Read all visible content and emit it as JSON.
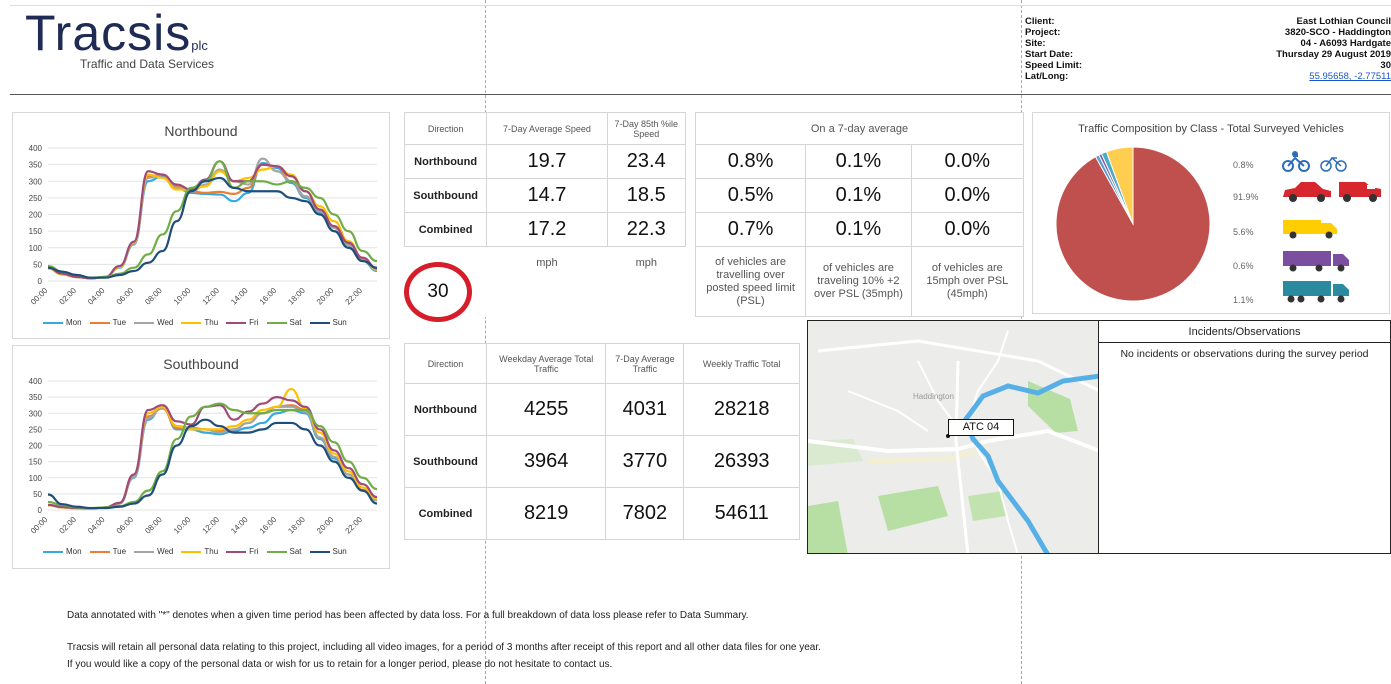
{
  "header": {
    "logo_text": "Tracsis",
    "logo_suffix": "plc",
    "logo_subtitle": "Traffic and Data Services",
    "info": [
      {
        "label": "Client:",
        "value": "East Lothian Council"
      },
      {
        "label": "Project:",
        "value": "3820-SCO - Haddington"
      },
      {
        "label": "Site:",
        "value": "04 - A6093 Hardgate"
      },
      {
        "label": "Start Date:",
        "value": "Thursday 29 August 2019"
      },
      {
        "label": "Speed Limit:",
        "value": "30"
      },
      {
        "label": "Lat/Long:",
        "value": "55.95658, -2.77511"
      }
    ]
  },
  "chart_data": [
    {
      "type": "line",
      "title": "Northbound",
      "x": [
        "00:00",
        "01:00",
        "02:00",
        "03:00",
        "04:00",
        "05:00",
        "06:00",
        "07:00",
        "08:00",
        "09:00",
        "10:00",
        "11:00",
        "12:00",
        "13:00",
        "14:00",
        "15:00",
        "16:00",
        "17:00",
        "18:00",
        "19:00",
        "20:00",
        "21:00",
        "22:00",
        "23:00"
      ],
      "xticks": [
        "00:00",
        "02:00",
        "04:00",
        "06:00",
        "08:00",
        "10:00",
        "12:00",
        "14:00",
        "16:00",
        "18:00",
        "20:00",
        "22:00"
      ],
      "ylim": [
        0,
        400
      ],
      "yticks": [
        0,
        50,
        100,
        150,
        200,
        250,
        300,
        350,
        400
      ],
      "series": [
        {
          "name": "Mon",
          "color": "#35a9e0",
          "values": [
            40,
            22,
            12,
            8,
            12,
            40,
            110,
            300,
            315,
            280,
            265,
            262,
            260,
            240,
            265,
            355,
            340,
            295,
            250,
            205,
            150,
            100,
            60,
            30
          ]
        },
        {
          "name": "Tue",
          "color": "#ed7d31",
          "values": [
            38,
            20,
            12,
            8,
            12,
            42,
            115,
            315,
            320,
            285,
            270,
            265,
            268,
            262,
            280,
            350,
            345,
            300,
            255,
            210,
            160,
            110,
            65,
            35
          ]
        },
        {
          "name": "Wed",
          "color": "#a5a5a5",
          "values": [
            38,
            20,
            12,
            8,
            12,
            42,
            112,
            310,
            318,
            280,
            268,
            290,
            335,
            300,
            290,
            368,
            330,
            300,
            255,
            210,
            160,
            108,
            62,
            33
          ]
        },
        {
          "name": "Thu",
          "color": "#ffc000",
          "values": [
            38,
            20,
            12,
            8,
            12,
            42,
            115,
            320,
            310,
            275,
            275,
            285,
            330,
            300,
            310,
            335,
            345,
            320,
            270,
            225,
            180,
            120,
            70,
            35
          ]
        },
        {
          "name": "Fri",
          "color": "#9e4a7a",
          "values": [
            40,
            22,
            12,
            8,
            12,
            45,
            118,
            330,
            320,
            290,
            275,
            305,
            360,
            300,
            300,
            350,
            345,
            315,
            270,
            215,
            165,
            115,
            70,
            38
          ]
        },
        {
          "name": "Sat",
          "color": "#70ad47",
          "values": [
            45,
            28,
            18,
            10,
            12,
            22,
            40,
            80,
            140,
            210,
            280,
            300,
            360,
            280,
            300,
            300,
            290,
            300,
            280,
            250,
            200,
            150,
            90,
            60
          ]
        },
        {
          "name": "Sun",
          "color": "#1f4e79",
          "values": [
            40,
            28,
            18,
            10,
            10,
            18,
            30,
            55,
            90,
            180,
            270,
            300,
            310,
            280,
            270,
            270,
            270,
            250,
            240,
            200,
            150,
            100,
            60,
            40
          ]
        }
      ]
    },
    {
      "type": "line",
      "title": "Southbound",
      "x": [
        "00:00",
        "01:00",
        "02:00",
        "03:00",
        "04:00",
        "05:00",
        "06:00",
        "07:00",
        "08:00",
        "09:00",
        "10:00",
        "11:00",
        "12:00",
        "13:00",
        "14:00",
        "15:00",
        "16:00",
        "17:00",
        "18:00",
        "19:00",
        "20:00",
        "21:00",
        "22:00",
        "23:00"
      ],
      "xticks": [
        "00:00",
        "02:00",
        "04:00",
        "06:00",
        "08:00",
        "10:00",
        "12:00",
        "14:00",
        "16:00",
        "18:00",
        "20:00",
        "22:00"
      ],
      "ylim": [
        0,
        400
      ],
      "yticks": [
        0,
        50,
        100,
        150,
        200,
        250,
        300,
        350,
        400
      ],
      "series": [
        {
          "name": "Mon",
          "color": "#35a9e0",
          "values": [
            15,
            8,
            5,
            5,
            8,
            20,
            100,
            280,
            320,
            250,
            250,
            240,
            235,
            245,
            255,
            270,
            300,
            310,
            300,
            220,
            160,
            110,
            60,
            30
          ]
        },
        {
          "name": "Tue",
          "color": "#ed7d31",
          "values": [
            15,
            8,
            5,
            5,
            8,
            20,
            105,
            290,
            315,
            255,
            255,
            250,
            245,
            250,
            270,
            300,
            320,
            325,
            310,
            225,
            165,
            110,
            62,
            32
          ]
        },
        {
          "name": "Wed",
          "color": "#a5a5a5",
          "values": [
            15,
            8,
            5,
            5,
            8,
            20,
            102,
            285,
            318,
            260,
            255,
            250,
            240,
            250,
            270,
            300,
            320,
            320,
            305,
            225,
            165,
            110,
            60,
            30
          ]
        },
        {
          "name": "Thu",
          "color": "#ffc000",
          "values": [
            15,
            8,
            5,
            5,
            8,
            22,
            110,
            300,
            320,
            260,
            250,
            250,
            250,
            260,
            280,
            310,
            320,
            375,
            315,
            240,
            175,
            120,
            70,
            35
          ]
        },
        {
          "name": "Fri",
          "color": "#9e4a7a",
          "values": [
            16,
            9,
            6,
            5,
            8,
            22,
            110,
            310,
            325,
            275,
            265,
            320,
            325,
            280,
            305,
            330,
            350,
            340,
            320,
            250,
            185,
            130,
            80,
            40
          ]
        },
        {
          "name": "Sat",
          "color": "#70ad47",
          "values": [
            25,
            15,
            8,
            6,
            8,
            12,
            25,
            60,
            120,
            220,
            290,
            320,
            330,
            310,
            300,
            300,
            310,
            310,
            310,
            260,
            210,
            150,
            100,
            65
          ]
        },
        {
          "name": "Sun",
          "color": "#1f4e79",
          "values": [
            48,
            18,
            10,
            6,
            6,
            10,
            20,
            45,
            110,
            200,
            260,
            280,
            260,
            240,
            240,
            250,
            270,
            270,
            250,
            200,
            150,
            100,
            60,
            20
          ]
        }
      ]
    },
    {
      "type": "pie",
      "title": "Traffic Composition by Class - Total Surveyed Vehicles",
      "slices": [
        {
          "label": "0.8%",
          "value": 0.8,
          "color": "#5b9bd5"
        },
        {
          "label": "91.9%",
          "value": 91.9,
          "color": "#c0504d"
        },
        {
          "label": "5.6%",
          "value": 5.6,
          "color": "#ffcd50"
        },
        {
          "label": "0.6%",
          "value": 0.6,
          "color": "#7b5ea7"
        },
        {
          "label": "1.1%",
          "value": 1.1,
          "color": "#4bacc6"
        }
      ]
    }
  ],
  "speed_table": {
    "headers": [
      "Direction",
      "7-Day Average Speed",
      "7-Day 85th %ile Speed",
      "On a 7-day average"
    ],
    "rows": [
      {
        "direction": "Northbound",
        "avg": "19.7",
        "p85": "23.4",
        "psl": "0.8%",
        "psl10": "0.1%",
        "psl15": "0.0%"
      },
      {
        "direction": "Southbound",
        "avg": "14.7",
        "p85": "18.5",
        "psl": "0.5%",
        "psl10": "0.1%",
        "psl15": "0.0%"
      },
      {
        "direction": "Combined",
        "avg": "17.2",
        "p85": "22.3",
        "psl": "0.7%",
        "psl10": "0.1%",
        "psl15": "0.0%"
      }
    ],
    "unit1": "mph",
    "unit2": "mph",
    "desc_psl": "of vehicles are travelling over posted speed limit (PSL)",
    "desc_psl10": "of vehicles are traveling 10% +2 over PSL (35mph)",
    "desc_psl15": "of vehicles are 15mph over PSL (45mph)"
  },
  "speed_limit_sign": "30",
  "volume_table": {
    "headers": [
      "Direction",
      "Weekday Average Total Traffic",
      "7-Day Average Traffic",
      "Weekly Traffic Total"
    ],
    "rows": [
      {
        "direction": "Northbound",
        "weekday": "4255",
        "avg7": "4031",
        "weekly": "28218"
      },
      {
        "direction": "Southbound",
        "weekday": "3964",
        "avg7": "3770",
        "weekly": "26393"
      },
      {
        "direction": "Combined",
        "weekday": "8219",
        "avg7": "7802",
        "weekly": "54611"
      }
    ]
  },
  "map": {
    "marker_label": "ATC 04",
    "place_label": "Haddington"
  },
  "incidents": {
    "title": "Incidents/Observations",
    "text": "No incidents or observations during the survey period"
  },
  "footer": {
    "line1": "Data annotated with \"*\" denotes when a given time period has been affected by data loss. For a full breakdown of data loss please refer to Data Summary.",
    "line2": "Tracsis will retain all personal data relating to this project, including all video images, for a period of 3 months after receipt of this report and all other data files for one year.",
    "line3": "If you would like a copy of the personal data or wish for us to retain for a longer period, please do not hesitate to contact us."
  }
}
